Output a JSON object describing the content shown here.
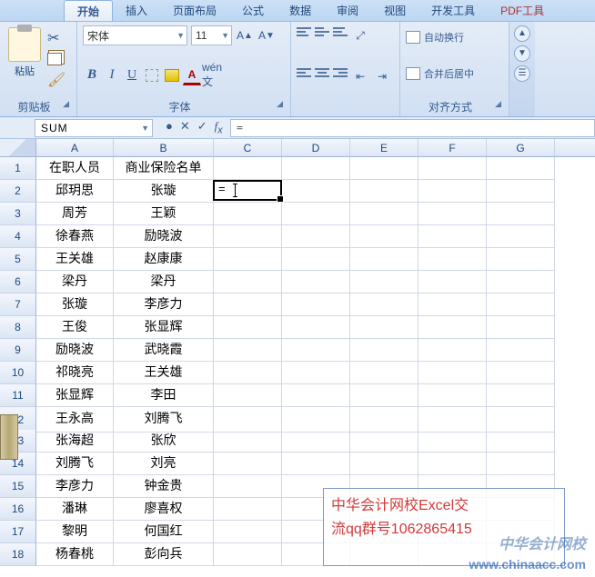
{
  "tabs": {
    "start": "开始",
    "insert": "插入",
    "layout": "页面布局",
    "formula": "公式",
    "data": "数据",
    "review": "审阅",
    "view": "视图",
    "dev": "开发工具",
    "pdf": "PDF工具"
  },
  "clipboard": {
    "paste": "粘贴",
    "title": "剪贴板"
  },
  "font": {
    "name": "宋体",
    "size": "11",
    "title": "字体"
  },
  "align": {
    "wrap": "自动换行",
    "merge": "合并后居中",
    "title": "对齐方式"
  },
  "namebox": "SUM",
  "formula_bar": "=",
  "cols": {
    "a": "A",
    "b": "B",
    "c": "C",
    "d": "D",
    "e": "E",
    "f": "F",
    "g": "G"
  },
  "ws": {
    "a1": "在职人员",
    "b1": "商业保险名单",
    "a2": "邱玥思",
    "b2": "张璇",
    "c2": "=",
    "a3": "周芳",
    "b3": "王颖",
    "a4": "徐春燕",
    "b4": "励晓波",
    "a5": "王关雄",
    "b5": "赵康康",
    "a6": "梁丹",
    "b6": "梁丹",
    "a7": "张璇",
    "b7": "李彦力",
    "a8": "王俊",
    "b8": "张显辉",
    "a9": "励晓波",
    "b9": "武晓霞",
    "a10": "祁晓亮",
    "b10": "王关雄",
    "a11": "张显辉",
    "b11": "李田",
    "a12": "王永高",
    "b12": "刘腾飞",
    "a13": "张海超",
    "b13": "张欣",
    "a14": "刘腾飞",
    "b14": "刘亮",
    "a15": "李彦力",
    "b15": "钟金贵",
    "a16": "潘琳",
    "b16": "廖喜权",
    "a17": "黎明",
    "b17": "何国红",
    "a18": "杨春桃",
    "b18": "彭向兵"
  },
  "overlay": {
    "line1": "中华会计网校Excel交",
    "line2": "流qq群号1062865415"
  },
  "wm": {
    "brand": "中华会计网校",
    "url": "www.chinaacc.com"
  }
}
